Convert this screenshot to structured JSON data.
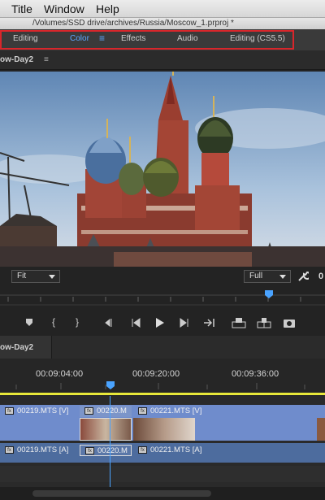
{
  "menubar": {
    "items": [
      "Title",
      "Window",
      "Help"
    ]
  },
  "window": {
    "path": "/Volumes/SSD drive/archives/Russia/Moscow_1.prproj *"
  },
  "workspaces": {
    "tabs": [
      {
        "label": "Editing",
        "active": false
      },
      {
        "label": "Color",
        "active": true
      },
      {
        "label": "Effects",
        "active": false
      },
      {
        "label": "Audio",
        "active": false
      },
      {
        "label": "Editing (CS5.5)",
        "active": false
      }
    ],
    "menu_glyph": "≡"
  },
  "monitor": {
    "title": "ow-Day2",
    "menu_glyph": "≡",
    "zoom": "Fit",
    "resolution": "Full",
    "timecode_partial": "0"
  },
  "timeline": {
    "title": "ow-Day2",
    "timecodes": [
      "00:09:04:00",
      "00:09:20:00",
      "00:09:36:00"
    ],
    "video_clips": [
      "00219.MTS [V]",
      "00220.M",
      "00221.MTS [V]"
    ],
    "audio_clips": [
      "00219.MTS [A]",
      "00220.M",
      "00221.MTS [A]"
    ],
    "fx_label": "fx"
  },
  "colors": {
    "accent": "#5aa6ff",
    "highlight_box": "#d8262b",
    "playhead": "#4aa3ff",
    "work_area": "#e8e83a"
  }
}
